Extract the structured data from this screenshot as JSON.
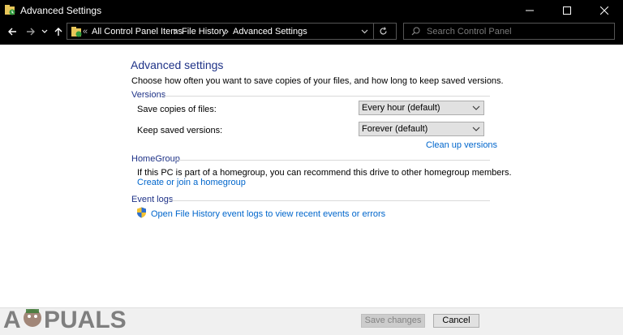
{
  "window": {
    "title": "Advanced Settings"
  },
  "breadcrumb": {
    "overflow": "«",
    "items": [
      "All Control Panel Items",
      "File History",
      "Advanced Settings"
    ]
  },
  "search": {
    "placeholder": "Search Control Panel"
  },
  "main": {
    "heading": "Advanced settings",
    "description": "Choose how often you want to save copies of your files, and how long to keep saved versions."
  },
  "versions": {
    "header": "Versions",
    "save_copies_label": "Save copies of files:",
    "save_copies_value": "Every hour (default)",
    "keep_versions_label": "Keep saved versions:",
    "keep_versions_value": "Forever (default)",
    "cleanup_link": "Clean up versions"
  },
  "homegroup": {
    "header": "HomeGroup",
    "text": "If this PC is part of a homegroup, you can recommend this drive to other homegroup members.",
    "link": "Create or join a homegroup"
  },
  "event_logs": {
    "header": "Event logs",
    "link": "Open File History event logs to view recent events or errors"
  },
  "buttons": {
    "save": "Save changes",
    "cancel": "Cancel"
  },
  "watermark": {
    "text": "APPUALS"
  },
  "colors": {
    "heading": "#1e3287",
    "link": "#0066cc",
    "chrome": "#000000"
  }
}
